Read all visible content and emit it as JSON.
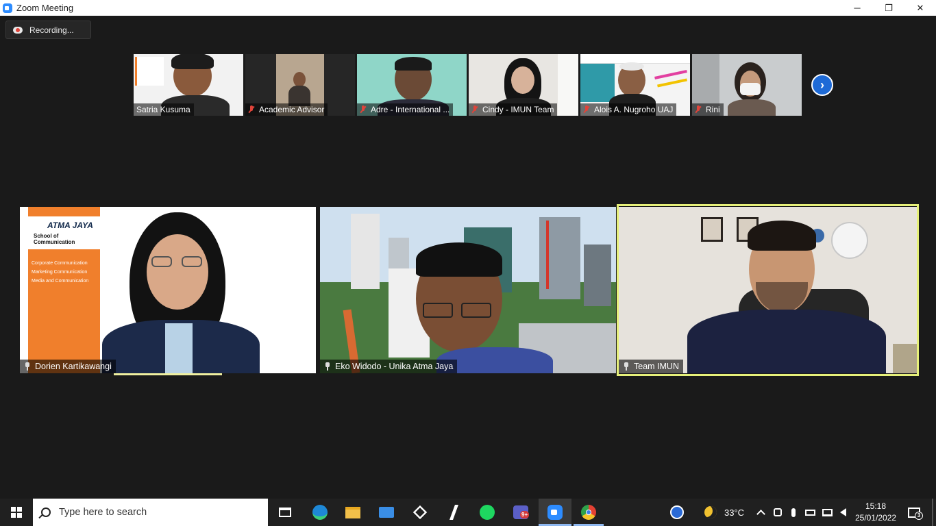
{
  "window": {
    "title": "Zoom Meeting",
    "minimize": "─",
    "restore": "❐",
    "close": "✕"
  },
  "recording": {
    "label": "Recording..."
  },
  "thumbnails": [
    {
      "name": "Satria Kusuma",
      "muted": false,
      "bg": "#f2f2f2"
    },
    {
      "name": "Academic Advisor",
      "muted": true,
      "bg": "#2a2a2a"
    },
    {
      "name": "Adre - International ...",
      "muted": true,
      "bg": "#8fd6c8"
    },
    {
      "name": "Cindy - IMUN Team",
      "muted": true,
      "bg": "#e8e6e2"
    },
    {
      "name": "Alois A. Nugroho UAJ",
      "muted": true,
      "bg": "#f4f4f4"
    },
    {
      "name": "Rini",
      "muted": true,
      "bg": "#c9ccce"
    }
  ],
  "next_page_icon": "›",
  "tiles": [
    {
      "name": "Dorien Kartikawangi",
      "slide": {
        "logo": "ATMA JAYA",
        "subtitle": "School of Communication",
        "items": [
          "Corporate Communication",
          "Marketing Communication",
          "Media and Communication"
        ]
      }
    },
    {
      "name": "Eko Widodo - Unika Atma Jaya"
    },
    {
      "name": "Team IMUN"
    }
  ],
  "taskbar": {
    "search_placeholder": "Type here to search",
    "teams_badge": "9+",
    "temperature": "33°C",
    "time": "15:18",
    "date": "25/01/2022",
    "notification_count": "3"
  },
  "colors": {
    "zoom_blue": "#2d8cff",
    "active_speaker": "#e6f07a",
    "muted_red": "#e0443a",
    "atma_orange": "#f07f2c"
  }
}
